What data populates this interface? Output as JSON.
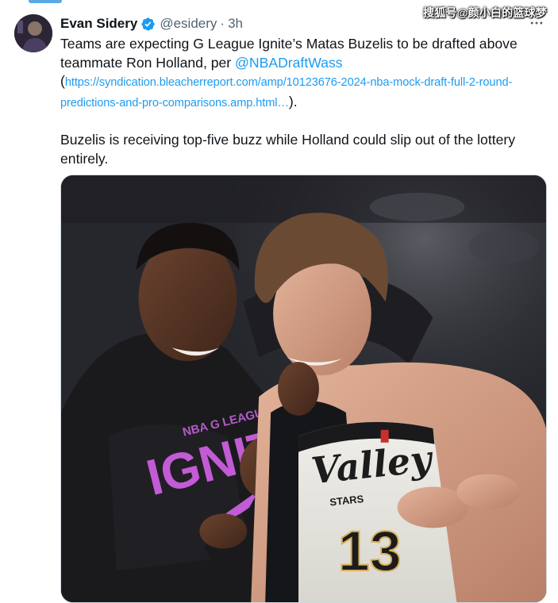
{
  "watermark": "搜狐号@颜小白的篮球梦",
  "author": {
    "name": "Evan Sidery",
    "handle": "@esidery",
    "separator": "·",
    "time": "3h",
    "verified": true,
    "avatar_icon": "user-avatar"
  },
  "tweet": {
    "line1_prefix": "Teams are expecting G League Ignite’s Matas Buzelis to be drafted above teammate Ron Holland, per ",
    "mention": "@NBADraftWass",
    "open_paren": "(",
    "url": "https://syndication.bleacherreport.com/amp/10123676-2024-nba-mock-draft-full-2-round-predictions-and-pro-comparisons.amp.html…",
    "close_paren": ").",
    "paragraph2": "Buzelis is receiving top-five buzz while Holland could slip out of the lottery entirely."
  },
  "media": {
    "jersey_left_text": "NBA G LEAGUE",
    "jersey_left_brand": "IGNITE",
    "jersey_right_script": "Valley",
    "jersey_right_sub": "STARS",
    "jersey_number": "13"
  },
  "colors": {
    "link": "#1d9bf0",
    "text": "#0f1419",
    "muted": "#536471",
    "verified": "#1d9bf0"
  },
  "icons": {
    "verified": "verified-badge-icon",
    "more": "more-options-icon"
  }
}
